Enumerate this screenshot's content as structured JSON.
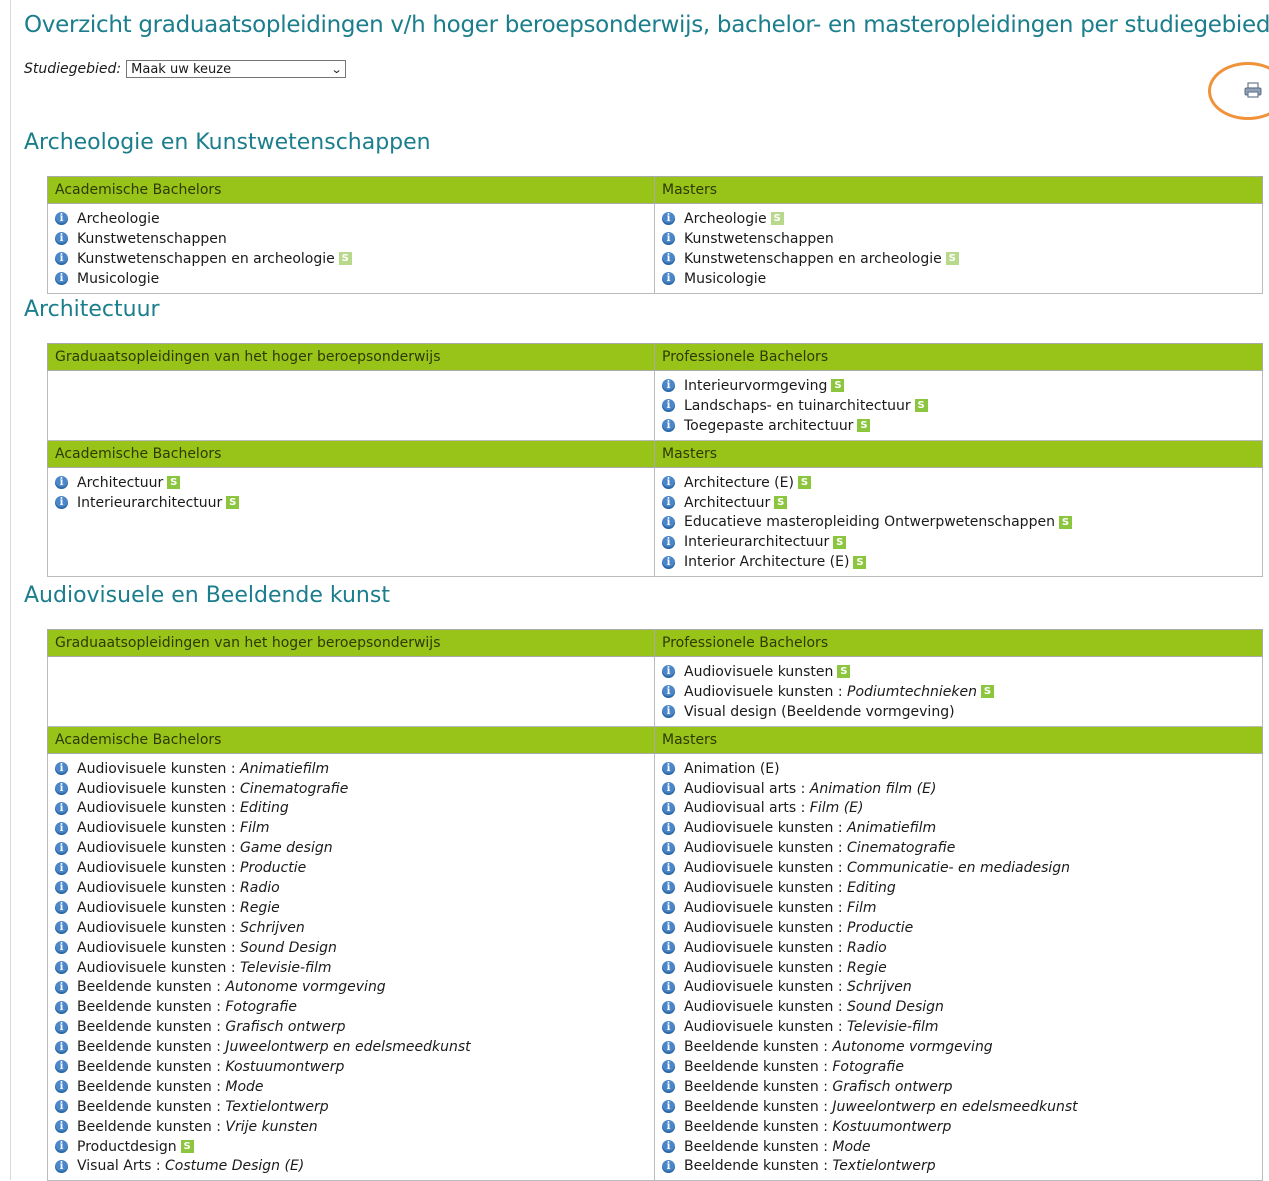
{
  "page": {
    "title": "Overzicht graduaatsopleidingen v/h hoger beroepsonderwijs, bachelor- en masteropleidingen per studiegebied",
    "filter_label": "Studiegebied:",
    "filter_value": "Maak uw keuze",
    "print_icon": "printer-icon"
  },
  "icons": {
    "info": "i",
    "info_name": "info-icon",
    "s_badge": "S"
  },
  "colors": {
    "heading": "#1b7e8c",
    "header_bar": "#98c41a",
    "info": "#4a86c8",
    "badge": "#8cc63e",
    "highlight_ring": "#f0923a"
  },
  "sections": [
    {
      "title": "Archeologie en Kunstwetenschappen",
      "rows": [
        {
          "left_header": "Academische Bachelors",
          "right_header": "Masters",
          "left": [
            {
              "name": "Archeologie"
            },
            {
              "name": "Kunstwetenschappen"
            },
            {
              "name": "Kunstwetenschappen en archeologie",
              "badge": "light"
            },
            {
              "name": "Musicologie"
            }
          ],
          "right": [
            {
              "name": "Archeologie",
              "badge": "light"
            },
            {
              "name": "Kunstwetenschappen"
            },
            {
              "name": "Kunstwetenschappen en archeologie",
              "badge": "light"
            },
            {
              "name": "Musicologie"
            }
          ]
        }
      ]
    },
    {
      "title": "Architectuur",
      "rows": [
        {
          "left_header": "Graduaatsopleidingen van het hoger beroepsonderwijs",
          "right_header": "Professionele Bachelors",
          "left": [],
          "right": [
            {
              "name": "Interieurvormgeving",
              "badge": "dark"
            },
            {
              "name": "Landschaps- en tuinarchitectuur",
              "badge": "dark"
            },
            {
              "name": "Toegepaste architectuur",
              "badge": "dark"
            }
          ]
        },
        {
          "left_header": "Academische Bachelors",
          "right_header": "Masters",
          "left": [
            {
              "name": "Architectuur",
              "badge": "dark"
            },
            {
              "name": "Interieurarchitectuur",
              "badge": "dark"
            }
          ],
          "right": [
            {
              "name": "Architecture (E)",
              "badge": "dark"
            },
            {
              "name": "Architectuur",
              "badge": "dark"
            },
            {
              "name": "Educatieve masteropleiding Ontwerpwetenschappen",
              "badge": "dark"
            },
            {
              "name": "Interieurarchitectuur",
              "badge": "dark"
            },
            {
              "name": "Interior Architecture (E)",
              "badge": "dark"
            }
          ]
        }
      ]
    },
    {
      "title": "Audiovisuele en Beeldende kunst",
      "rows": [
        {
          "left_header": "Graduaatsopleidingen van het hoger beroepsonderwijs",
          "right_header": "Professionele Bachelors",
          "left": [],
          "right": [
            {
              "name": "Audiovisuele kunsten",
              "badge": "dark"
            },
            {
              "name": "Audiovisuele kunsten",
              "spec": "Podiumtechnieken",
              "badge": "dark"
            },
            {
              "name": "Visual design (Beeldende vormgeving)"
            }
          ]
        },
        {
          "left_header": "Academische Bachelors",
          "right_header": "Masters",
          "left": [
            {
              "name": "Audiovisuele kunsten",
              "spec": "Animatiefilm"
            },
            {
              "name": "Audiovisuele kunsten",
              "spec": "Cinematografie"
            },
            {
              "name": "Audiovisuele kunsten",
              "spec": "Editing"
            },
            {
              "name": "Audiovisuele kunsten",
              "spec": "Film"
            },
            {
              "name": "Audiovisuele kunsten",
              "spec": "Game design"
            },
            {
              "name": "Audiovisuele kunsten",
              "spec": "Productie"
            },
            {
              "name": "Audiovisuele kunsten",
              "spec": "Radio"
            },
            {
              "name": "Audiovisuele kunsten",
              "spec": "Regie"
            },
            {
              "name": "Audiovisuele kunsten",
              "spec": "Schrijven"
            },
            {
              "name": "Audiovisuele kunsten",
              "spec": "Sound Design"
            },
            {
              "name": "Audiovisuele kunsten",
              "spec": "Televisie-film"
            },
            {
              "name": "Beeldende kunsten",
              "spec": "Autonome vormgeving"
            },
            {
              "name": "Beeldende kunsten",
              "spec": "Fotografie"
            },
            {
              "name": "Beeldende kunsten",
              "spec": "Grafisch ontwerp"
            },
            {
              "name": "Beeldende kunsten",
              "spec": "Juweelontwerp en edelsmeedkunst"
            },
            {
              "name": "Beeldende kunsten",
              "spec": "Kostuumontwerp"
            },
            {
              "name": "Beeldende kunsten",
              "spec": "Mode"
            },
            {
              "name": "Beeldende kunsten",
              "spec": "Textielontwerp"
            },
            {
              "name": "Beeldende kunsten",
              "spec": "Vrije kunsten"
            },
            {
              "name": "Productdesign",
              "badge": "dark"
            },
            {
              "name": "Visual Arts",
              "spec": "Costume Design (E)"
            }
          ],
          "right": [
            {
              "name": "Animation (E)"
            },
            {
              "name": "Audiovisual arts",
              "spec": "Animation film (E)"
            },
            {
              "name": "Audiovisual arts",
              "spec": "Film (E)"
            },
            {
              "name": "Audiovisuele kunsten",
              "spec": "Animatiefilm"
            },
            {
              "name": "Audiovisuele kunsten",
              "spec": "Cinematografie"
            },
            {
              "name": "Audiovisuele kunsten",
              "spec": "Communicatie- en mediadesign"
            },
            {
              "name": "Audiovisuele kunsten",
              "spec": "Editing"
            },
            {
              "name": "Audiovisuele kunsten",
              "spec": "Film"
            },
            {
              "name": "Audiovisuele kunsten",
              "spec": "Productie"
            },
            {
              "name": "Audiovisuele kunsten",
              "spec": "Radio"
            },
            {
              "name": "Audiovisuele kunsten",
              "spec": "Regie"
            },
            {
              "name": "Audiovisuele kunsten",
              "spec": "Schrijven"
            },
            {
              "name": "Audiovisuele kunsten",
              "spec": "Sound Design"
            },
            {
              "name": "Audiovisuele kunsten",
              "spec": "Televisie-film"
            },
            {
              "name": "Beeldende kunsten",
              "spec": "Autonome vormgeving"
            },
            {
              "name": "Beeldende kunsten",
              "spec": "Fotografie"
            },
            {
              "name": "Beeldende kunsten",
              "spec": "Grafisch ontwerp"
            },
            {
              "name": "Beeldende kunsten",
              "spec": "Juweelontwerp en edelsmeedkunst"
            },
            {
              "name": "Beeldende kunsten",
              "spec": "Kostuumontwerp"
            },
            {
              "name": "Beeldende kunsten",
              "spec": "Mode"
            },
            {
              "name": "Beeldende kunsten",
              "spec": "Textielontwerp"
            }
          ]
        }
      ]
    }
  ]
}
